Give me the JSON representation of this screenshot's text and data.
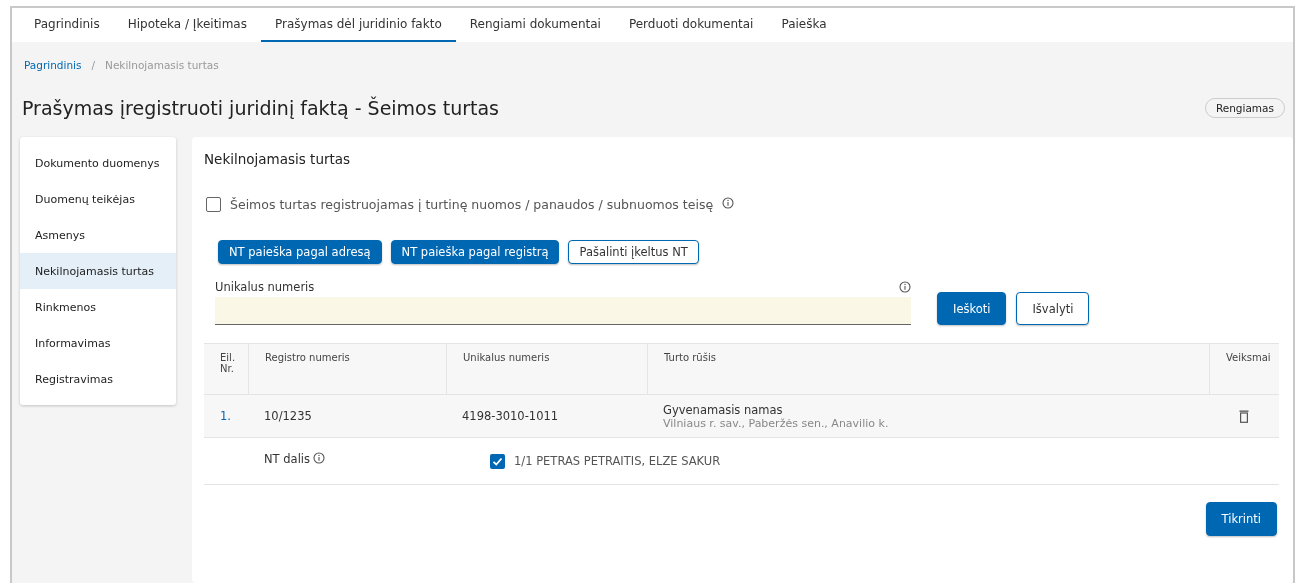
{
  "tabs": [
    {
      "label": "Pagrindinis",
      "selected": false
    },
    {
      "label": "Hipoteka / Įkeitimas",
      "selected": false
    },
    {
      "label": "Prašymas dėl juridinio fakto",
      "selected": true
    },
    {
      "label": "Rengiami dokumentai",
      "selected": false
    },
    {
      "label": "Perduoti dokumentai",
      "selected": false
    },
    {
      "label": "Paieška",
      "selected": false
    }
  ],
  "breadcrumb": {
    "link": "Pagrindinis",
    "separator": "/",
    "current": "Nekilnojamasis turtas"
  },
  "page_title": "Prašymas įregistruoti juridinį faktą - Šeimos turtas",
  "status_badge": "Rengiamas",
  "sidebar": {
    "items": [
      {
        "label": "Dokumento duomenys",
        "selected": false
      },
      {
        "label": "Duomenų teikėjas",
        "selected": false
      },
      {
        "label": "Asmenys",
        "selected": false
      },
      {
        "label": "Nekilnojamasis turtas",
        "selected": true
      },
      {
        "label": "Rinkmenos",
        "selected": false
      },
      {
        "label": "Informavimas",
        "selected": false
      },
      {
        "label": "Registravimas",
        "selected": false
      }
    ]
  },
  "section_title": "Nekilnojamasis turtas",
  "lease_checkbox": {
    "label": "Šeimos turtas registruojamas į turtinę nuomos / panaudos / subnuomos teisę",
    "checked": false
  },
  "action_buttons": [
    {
      "label": "NT paieška pagal adresą",
      "kind": "primary"
    },
    {
      "label": "NT paieška pagal registrą",
      "kind": "primary"
    },
    {
      "label": "Pašalinti įkeltus NT",
      "kind": "outline"
    }
  ],
  "search": {
    "label": "Unikalus numeris",
    "buttons": [
      {
        "label": "Ieškoti",
        "kind": "primary"
      },
      {
        "label": "Išvalyti",
        "kind": "outline"
      }
    ]
  },
  "table": {
    "columns": [
      "Eil. Nr.",
      "Registro numeris",
      "Unikalus numeris",
      "Turto rūšis",
      "Veiksmai"
    ],
    "rows": [
      {
        "index": "1.",
        "register_no": "10/1235",
        "unique_no": "4198-3010-1011",
        "type": "Gyvenamasis namas",
        "address": "Vilniaus r. sav., Paberžės sen., Anavilio k.",
        "share": {
          "label": "NT dalis",
          "owner": "1/1 PETRAS PETRAITIS, ELZE SAKUR",
          "checked": true
        }
      }
    ]
  },
  "submit_button": "Tikrinti"
}
